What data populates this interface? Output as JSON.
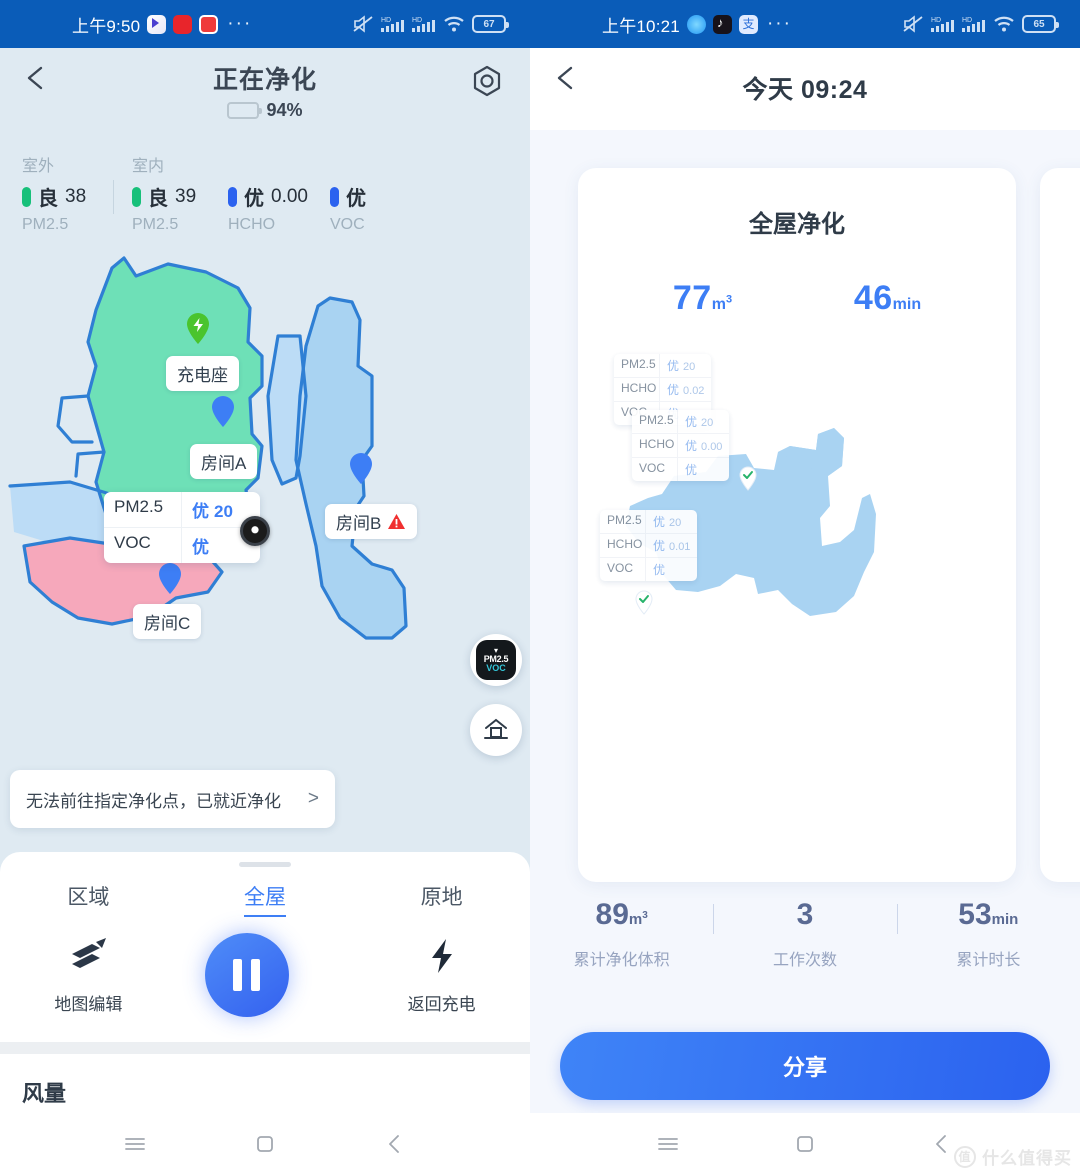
{
  "left": {
    "status_bar": {
      "time": "上午9:50",
      "apps": [
        "play-store-icon",
        "red-app-icon",
        "red-note-icon"
      ],
      "overflow": "···",
      "icons": [
        "mute-icon",
        "signal-hd-1-icon",
        "signal-hd-2-icon",
        "wifi-icon"
      ],
      "battery": "67"
    },
    "appbar": {
      "back": "back-chevron-icon",
      "title": "正在净化",
      "battery_percent": "94%",
      "battery_level": 94,
      "settings": "gear-hex-icon"
    },
    "air_quality": [
      {
        "scope": "室外",
        "items": [
          {
            "name": "PM2.5",
            "level": "良",
            "value": "38",
            "color": "#17c07a"
          }
        ]
      },
      {
        "scope": "室内",
        "items": [
          {
            "name": "PM2.5",
            "level": "良",
            "value": "39",
            "color": "#17c07a"
          },
          {
            "name": "HCHO",
            "level": "优",
            "value": "0.00",
            "color": "#2b62ef"
          },
          {
            "name": "VOC",
            "level": "优",
            "value": "",
            "color": "#2b62ef"
          }
        ]
      }
    ],
    "map": {
      "labels": [
        {
          "name": "dock-label",
          "text": "充电座",
          "warning": false
        },
        {
          "name": "room-a-label",
          "text": "房间A",
          "warning": false
        },
        {
          "name": "room-b-label",
          "text": "房间B",
          "warning": true
        },
        {
          "name": "room-c-label",
          "text": "房间C",
          "warning": false
        }
      ],
      "reading_card": {
        "rows": [
          {
            "key": "PM2.5",
            "level": "优",
            "value": "20"
          },
          {
            "key": "VOC",
            "level": "优",
            "value": ""
          }
        ]
      },
      "sensor_chip": {
        "top": "PM2.5",
        "bottom": "VOC"
      },
      "home_fab": "home-icon"
    },
    "toast": {
      "text": "无法前往指定净化点，已就近净化",
      "arrow": ">"
    },
    "sheet": {
      "modes": [
        {
          "label": "区域",
          "active": false
        },
        {
          "label": "全屋",
          "active": true
        },
        {
          "label": "原地",
          "active": false
        }
      ],
      "left_action": {
        "icon": "map-edit-icon",
        "label": "地图编辑"
      },
      "center_action": {
        "icon": "pause-icon",
        "label": ""
      },
      "right_action": {
        "icon": "lightning-icon",
        "label": "返回充电"
      }
    },
    "fan": {
      "title": "风量"
    },
    "navbar": [
      "menu-icon",
      "home-square-icon",
      "back-icon"
    ]
  },
  "right": {
    "status_bar": {
      "time": "上午10:21",
      "apps": [
        "blue-circle-app-icon",
        "tiktok-icon",
        "alipay-icon"
      ],
      "overflow": "···",
      "icons": [
        "mute-icon",
        "signal-hd-1-icon",
        "signal-hd-2-icon",
        "wifi-icon"
      ],
      "battery": "65"
    },
    "appbar": {
      "back": "back-chevron-icon",
      "title": "今天 09:24"
    },
    "card": {
      "title": "全屋净化",
      "stats": [
        {
          "value": "77",
          "unit": "m³"
        },
        {
          "value": "46",
          "unit": "min"
        }
      ],
      "tips": [
        {
          "rows": [
            {
              "key": "PM2.5",
              "level": "优",
              "value": "20"
            },
            {
              "key": "HCHO",
              "level": "优",
              "value": "0.02"
            },
            {
              "key": "VOC",
              "level": "优",
              "value": ""
            }
          ]
        },
        {
          "rows": [
            {
              "key": "PM2.5",
              "level": "优",
              "value": "20"
            },
            {
              "key": "HCHO",
              "level": "优",
              "value": "0.00"
            },
            {
              "key": "VOC",
              "level": "优",
              "value": ""
            }
          ]
        },
        {
          "rows": [
            {
              "key": "PM2.5",
              "level": "优",
              "value": "20"
            },
            {
              "key": "HCHO",
              "level": "优",
              "value": "0.01"
            },
            {
              "key": "VOC",
              "level": "优",
              "value": ""
            }
          ]
        }
      ]
    },
    "totals": [
      {
        "value": "89",
        "unit": "m³",
        "label": "累计净化体积"
      },
      {
        "value": "3",
        "unit": "",
        "label": "工作次数"
      },
      {
        "value": "53",
        "unit": "min",
        "label": "累计时长"
      }
    ],
    "share_button": "分享",
    "navbar": [
      "menu-icon",
      "home-square-icon",
      "back-icon"
    ],
    "watermark": {
      "badge": "值",
      "text": "什么值得买"
    }
  }
}
